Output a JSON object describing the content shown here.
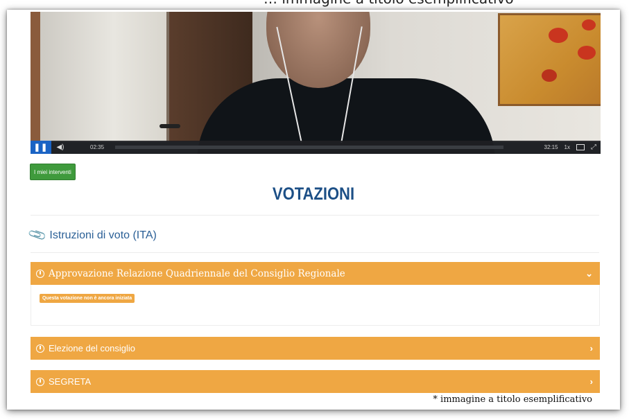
{
  "top_caption": "… immagine a titolo esemplificativo",
  "video": {
    "elapsed": "02:35",
    "duration": "32:15",
    "speed": "1x",
    "progress": 0.0
  },
  "my_interventions_button": "I miei interventi",
  "page_title": "VOTAZIONI",
  "instructions_link": "Istruzioni di voto (ITA)",
  "votes": [
    {
      "title": "Approvazione Relazione Quadriennale del Consiglio Regionale",
      "expanded": true,
      "status": "Questa votazione non è ancora iniziata"
    },
    {
      "title": "Elezione del consiglio",
      "expanded": false
    },
    {
      "title": "SEGRETA",
      "expanded": false
    }
  ],
  "footnote": "* immagine a titolo esemplificativo",
  "colors": {
    "accent_orange": "#efa743",
    "title_blue": "#1c4f86",
    "button_green": "#3f9a3c",
    "player_blue": "#1a63c4"
  }
}
